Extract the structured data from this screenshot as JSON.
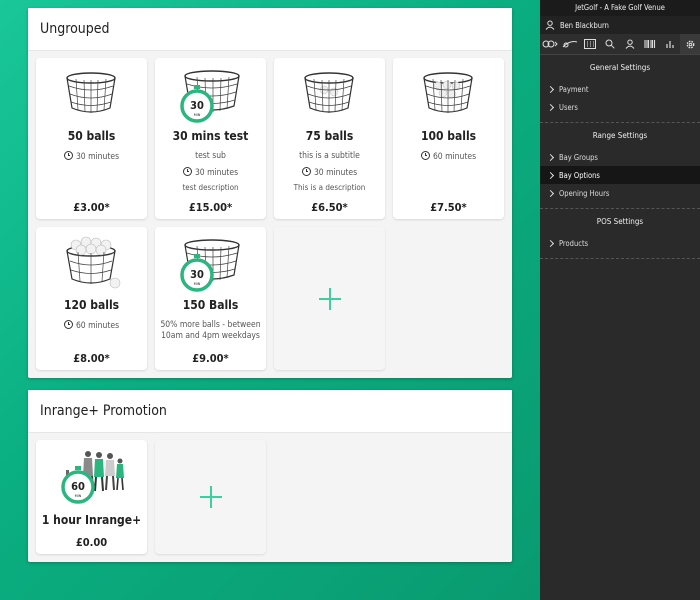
{
  "sidebar": {
    "title": "JetGolf - A Fake Golf Venue",
    "user_name": "Ben Blackburn",
    "toolbar_icons": [
      "golf-balls-icon",
      "golf-club-icon",
      "keypad-icon",
      "search-icon",
      "user-icon",
      "barcode-icon",
      "bar-chart-icon",
      "gear-icon"
    ],
    "sections": [
      {
        "heading": "General Settings",
        "items": [
          "Payment",
          "Users"
        ]
      },
      {
        "heading": "Range Settings",
        "items": [
          "Bay Groups",
          "Bay Options",
          "Opening Hours"
        ]
      },
      {
        "heading": "POS Settings",
        "items": [
          "Products"
        ]
      }
    ],
    "active_item": "Bay Options"
  },
  "groups": [
    {
      "title": "Ungrouped",
      "cards": [
        {
          "name": "50 balls",
          "subtitle": "",
          "duration": "30 minutes",
          "description": "",
          "price": "£3.00*",
          "image": "wire-basket",
          "badge": ""
        },
        {
          "name": "30 mins test",
          "subtitle": "test sub",
          "duration": "30 minutes",
          "description": "test description",
          "price": "£15.00*",
          "image": "wire-basket",
          "badge": "30"
        },
        {
          "name": "75 balls",
          "subtitle": "this is a subtitle",
          "duration": "30 minutes",
          "description": "This is a description",
          "price": "£6.50*",
          "image": "wire-basket",
          "badge": ""
        },
        {
          "name": "100 balls",
          "subtitle": "",
          "duration": "60 minutes",
          "description": "",
          "price": "£7.50*",
          "image": "wire-basket",
          "badge": ""
        },
        {
          "name": "120 balls",
          "subtitle": "",
          "duration": "60 minutes",
          "description": "",
          "price": "£8.00*",
          "image": "basket-with-balls",
          "badge": ""
        },
        {
          "name": "150 Balls",
          "subtitle": "50% more balls - between 10am and 4pm weekdays",
          "duration": "",
          "description": "",
          "price": "£9.00*",
          "image": "wire-basket",
          "badge": "30"
        }
      ]
    },
    {
      "title": "Inrange+ Promotion",
      "cards": [
        {
          "name": "1 hour Inrange+",
          "subtitle": "",
          "duration": "",
          "description": "",
          "price": "£0.00",
          "image": "inrange-people",
          "badge": "60",
          "badge_unit": "MIN"
        }
      ]
    }
  ],
  "badge_unit": "MIN",
  "colors": {
    "accent": "#3fcf9f",
    "badge_ring": "#2bb57f",
    "bg_start": "#19c799",
    "bg_end": "#0a9a70",
    "sidebar": "#2a2a2a"
  }
}
